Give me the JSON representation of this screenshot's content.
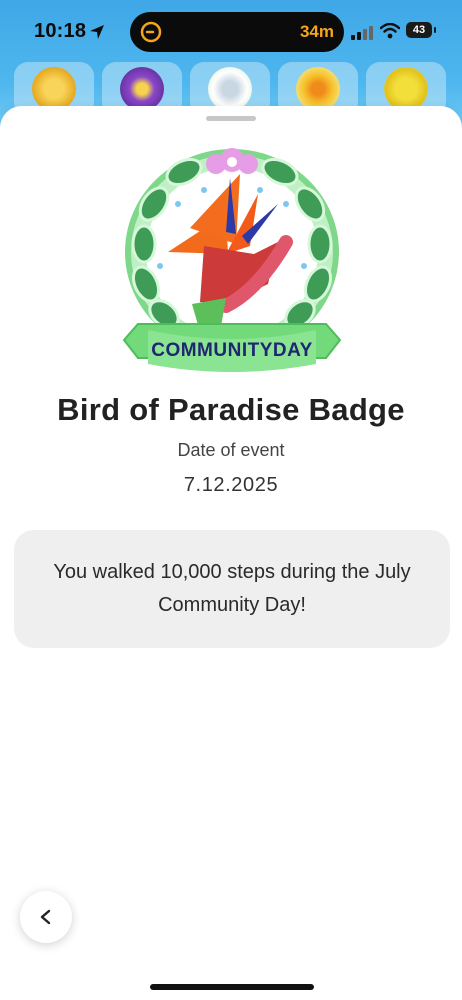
{
  "status_bar": {
    "time": "10:18",
    "timer": "34m",
    "battery": "43"
  },
  "badge_strip": {
    "items": [
      {
        "icon": "yellow-flower-badge-icon",
        "color": "#f2c233"
      },
      {
        "icon": "purple-flower-badge-icon",
        "color": "#8a47c9"
      },
      {
        "icon": "white-flower-badge-icon",
        "color": "#e9edf2"
      },
      {
        "icon": "yellow-daffodil-badge-icon",
        "color": "#f6b62b"
      },
      {
        "icon": "yellow-bloom-badge-icon",
        "color": "#f2df3a"
      }
    ]
  },
  "badge": {
    "ribbon_text": "COMMUNITYDAY",
    "title": "Bird of Paradise Badge",
    "date_label": "Date of event",
    "date_value": "7.12.2025",
    "message": "You walked 10,000 steps during the July Community Day!"
  },
  "colors": {
    "ribbon": "#5fd168",
    "wreath": "#6fd07d",
    "flower_orange": "#f26a1b",
    "flower_red": "#c93a3a",
    "stem": "#5cbf5a"
  },
  "navigation": {
    "back_icon": "chevron-left-icon"
  }
}
